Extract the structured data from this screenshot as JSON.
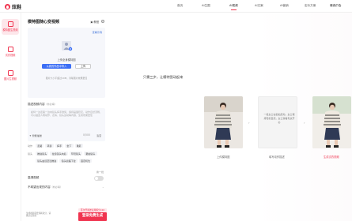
{
  "brand": {
    "name": "炫鞋",
    "logo_icon": "heart-bubble-icon",
    "accent": "#f0344f"
  },
  "nav": {
    "items": [
      {
        "label": "首页",
        "active": false
      },
      {
        "label": "AI生图",
        "active": false
      },
      {
        "label": "AI视频",
        "active": true
      },
      {
        "label": "AI文案",
        "active": false
      },
      {
        "label": "AI营销",
        "active": false
      },
      {
        "label": "定价方案",
        "active": false
      },
      {
        "label": "赚钱广告",
        "active": false
      },
      {
        "label": "个人中心",
        "active": false
      }
    ]
  },
  "sidebar": {
    "items": [
      {
        "label": "模特图生视频",
        "icon": "video-icon",
        "active": true
      },
      {
        "label": "试衣视频",
        "icon": "shirt-icon",
        "active": false
      },
      {
        "label": "图片生视频",
        "icon": "image-icon",
        "active": false
      }
    ]
  },
  "panel": {
    "title": "模特图随心变视频",
    "tutorial": "教程",
    "help": "?",
    "upload": {
      "example_link": "查看示例",
      "tip": "上传全身模特图",
      "from_works": "从我的作品中导入",
      "upload_btn": "上传",
      "note": "图片大小不超过10M，清晰图片效果更佳"
    },
    "description": {
      "label": "描述视频内容",
      "optional": "（非必填）",
      "placeholder": "模特一边走路一边向镜头挥手微笑，保持画面稳定，动作自然流畅，可以描述人物动作、表情、镜头运动等内容，生成效果更佳",
      "ai_polish": "智能描述",
      "count": "0/500",
      "clear": "清空"
    },
    "tags": {
      "row1_label": "动作",
      "row1": [
        "走路",
        "转身",
        "挥手",
        "坐下",
        "跳跃"
      ],
      "row2_label": "镜头",
      "row2": [
        "推进镜头",
        "拉远镜头向后",
        "环绕镜头",
        "跟拍镜头"
      ],
      "row3": [
        "镜头由远至近推进",
        "镜头摇摆下拉",
        "固定机位",
        "手持晃动"
      ],
      "more": "换一批"
    },
    "hd_toggle": {
      "label": "高清视频",
      "on": false
    },
    "no_want": {
      "label": "不希望出现的内容",
      "optional": "（非必填）"
    },
    "footer_note": "生成视频需要消耗积分，请确认后生成",
    "promo_badge": "首次开通送试用积分x10",
    "promo_btn": "登录免费生成"
  },
  "showcase": {
    "headline": "只需三步，让模特图动起来",
    "mid_text": "一段女士在街拍走动，女士保持轻松自然，女士穿着毛衣开衫",
    "steps": [
      "上传模特图",
      "填写动作描述",
      "生成试衣视频"
    ]
  }
}
